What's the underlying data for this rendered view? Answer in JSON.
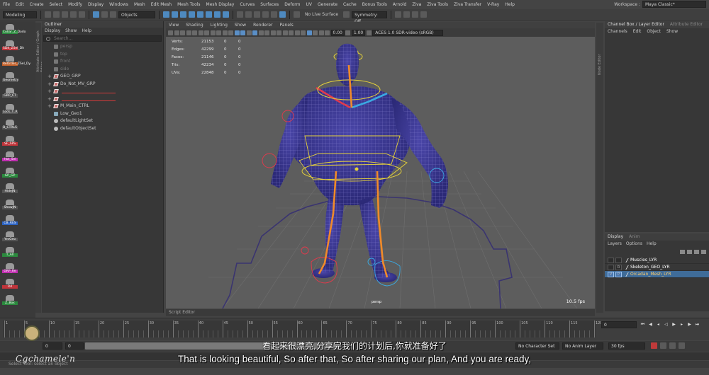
{
  "menubar": {
    "items": [
      "File",
      "Edit",
      "Create",
      "Select",
      "Modify",
      "Display",
      "Windows",
      "Mesh",
      "Edit Mesh",
      "Mesh Tools",
      "Mesh Display",
      "Curves",
      "Surfaces",
      "Deform",
      "UV",
      "Generate",
      "Cache",
      "Bonus Tools",
      "Arnold",
      "Ziva",
      "Ziva Tools",
      "Ziva Transfer",
      "V-Ray",
      "Help"
    ],
    "workspace_label": "Workspace :",
    "workspace_value": "Maya Classic*"
  },
  "statusline": {
    "menuset": "Modeling",
    "objects": "Objects",
    "live_surface": "No Live Surface",
    "symmetry": "Symmetry: Off"
  },
  "shelf": {
    "items": [
      {
        "icon": "collar-icon",
        "label": "Collar_Z_Dodo",
        "color": "green"
      },
      {
        "icon": "sdk-icon",
        "label": "SDK_ZSel_Dh",
        "color": "red"
      },
      {
        "icon": "reorder-icon",
        "label": "ReOrder_ZSel_Dy",
        "color": "orange"
      },
      {
        "icon": "geometry-icon",
        "label": "Geometry",
        "color": "grey"
      },
      {
        "icon": "grp-ct-icon",
        "label": "GRP_CT",
        "color": "grey"
      },
      {
        "icon": "lock-trs-icon",
        "label": "Lock_T_R",
        "color": "grey"
      },
      {
        "icon": "ctrls-icon",
        "label": "B_CTRLS",
        "color": "grey"
      },
      {
        "icon": "sf-sp-icon",
        "label": "SF_SPS",
        "color": "red"
      },
      {
        "icon": "hot-sel-icon",
        "label": "Hot_Sel",
        "color": "magenta"
      },
      {
        "icon": "gp-gp-icon",
        "label": "GP_GP",
        "color": "green"
      },
      {
        "icon": "hide-icon",
        "label": "HideJN",
        "color": "grey"
      },
      {
        "icon": "show-icon",
        "label": "ShowJN",
        "color": "grey"
      },
      {
        "icon": "cb-res-icon",
        "label": "CB_RES",
        "color": "blue"
      },
      {
        "icon": "yes-geo-icon",
        "label": "YesGeo",
        "color": "grey"
      },
      {
        "icon": "t-all-icon",
        "label": "T_All",
        "color": "green"
      },
      {
        "icon": "grp-re-icon",
        "label": "GRP_Re",
        "color": "magenta"
      },
      {
        "icon": "red-icon",
        "label": "Rd",
        "color": "red"
      },
      {
        "icon": "z-box-icon",
        "label": "Z_Box",
        "color": "green"
      }
    ]
  },
  "side_tabs": {
    "left": "Attribute Editor / Graph Editor",
    "right": "Node Editor"
  },
  "outliner": {
    "title": "Outliner",
    "menu": [
      "Display",
      "Show",
      "Help"
    ],
    "search_placeholder": "Search...",
    "rows": [
      {
        "label": "persp",
        "icon": "camera-icon",
        "dim": true
      },
      {
        "label": "top",
        "icon": "camera-icon",
        "dim": true
      },
      {
        "label": "front",
        "icon": "camera-icon",
        "dim": true
      },
      {
        "label": "side",
        "icon": "camera-icon",
        "dim": true
      },
      {
        "label": "GEO_GRP",
        "icon": "group-icon",
        "dim": false
      },
      {
        "label": "Do_Not_MV_GRP",
        "icon": "group-icon",
        "dim": false
      },
      {
        "label": "",
        "icon": "group-icon",
        "dim": false
      },
      {
        "label": "",
        "icon": "group-icon",
        "dim": false
      },
      {
        "label": "M_Main_CTRL",
        "icon": "group-icon",
        "dim": false
      },
      {
        "label": "Low_Geo1",
        "icon": "mesh-icon",
        "dim": false
      },
      {
        "label": "defaultLightSet",
        "icon": "set-icon",
        "dim": false
      },
      {
        "label": "defaultObjectSet",
        "icon": "set-icon",
        "dim": false
      }
    ]
  },
  "viewport": {
    "menu": [
      "View",
      "Shading",
      "Lighting",
      "Show",
      "Renderer",
      "Panels"
    ],
    "toolbar": {
      "near_value": "0.00",
      "gamma_value": "1.00",
      "colorspace": "ACES 1.0 SDR-video (sRGB)"
    },
    "hud": [
      {
        "label": "Verts:",
        "value": "21153",
        "sel": "0",
        "comp": "0"
      },
      {
        "label": "Edges:",
        "value": "42299",
        "sel": "0",
        "comp": "0"
      },
      {
        "label": "Faces:",
        "value": "21146",
        "sel": "0",
        "comp": "0"
      },
      {
        "label": "Tris:",
        "value": "42234",
        "sel": "0",
        "comp": "0"
      },
      {
        "label": "UVs:",
        "value": "22848",
        "sel": "0",
        "comp": "0"
      }
    ],
    "camera": "persp",
    "fps": "10.5 fps",
    "colors": {
      "background": "#5d5d5d",
      "mesh": "#3d3b8c",
      "wire": "#8e88d6",
      "rig_yellow": "#e6d23a",
      "rig_red": "#e23a4c",
      "rig_blue": "#3aa9e2",
      "joint_orange": "#f08a2a"
    }
  },
  "script_editor": "Script Editor",
  "channelbox": {
    "tabs": [
      "Channel Box / Layer Editor",
      "Attribute Editor"
    ],
    "menu": [
      "Channels",
      "Edit",
      "Object",
      "Show"
    ]
  },
  "layers": {
    "tabs": [
      "Display",
      "Anim"
    ],
    "menu": [
      "Layers",
      "Options",
      "Help"
    ],
    "rows": [
      {
        "v": "",
        "p": "",
        "name": "Muscles_LYR",
        "selected": false
      },
      {
        "v": "",
        "p": "R",
        "name": "Skeleton_GEO_LYR",
        "selected": false
      },
      {
        "v": "V",
        "p": "P",
        "name": "Orcadan_Mesh_LYR",
        "selected": true
      }
    ]
  },
  "timeline": {
    "ticks": [
      "1",
      "5",
      "10",
      "15",
      "20",
      "25",
      "30",
      "35",
      "40",
      "45",
      "50",
      "55",
      "60",
      "65",
      "70",
      "75",
      "80",
      "85",
      "90",
      "95",
      "100",
      "105",
      "110",
      "115",
      "120"
    ],
    "current_frame": "0"
  },
  "range": {
    "start": "0",
    "range_start": "0",
    "character_set": "No Character Set",
    "anim_layer": "No Anim Layer",
    "fps": "30 fps"
  },
  "helpline": "Select Tool: select an object",
  "watermark": "Cgchamele'n",
  "subtitles": {
    "chinese": "看起来很漂亮,分享完我们的计划后,你就准备好了",
    "english": "That is looking beautiful, So after that, So after sharing our plan, And you are ready,"
  }
}
